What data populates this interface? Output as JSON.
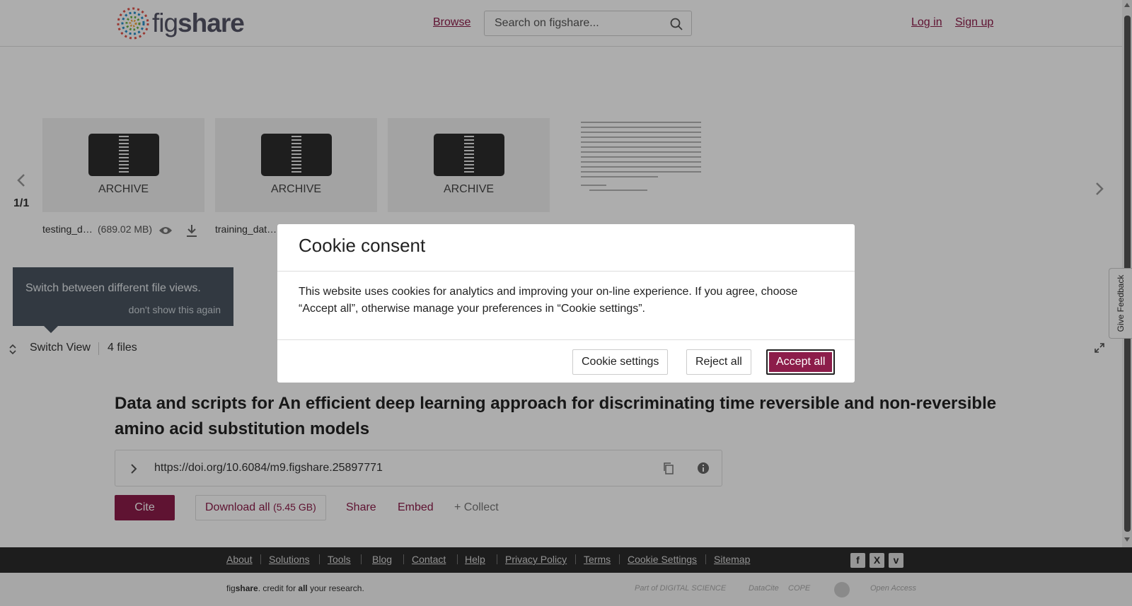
{
  "header": {
    "logo_prefix": "fig",
    "logo_suffix": "share",
    "browse_label": "Browse",
    "search_placeholder": "Search on figshare...",
    "login_label": "Log in",
    "signup_label": "Sign up"
  },
  "viewer": {
    "pager": "1/1",
    "tiles": [
      {
        "type_label": "ARCHIVE",
        "file_name": "testing_d…",
        "file_size": "(689.02 MB)"
      },
      {
        "type_label": "ARCHIVE",
        "file_name": "training_dat…"
      },
      {
        "type_label": "ARCHIVE"
      }
    ],
    "tooltip": {
      "message": "Switch between different file views.",
      "dismiss": "don't show this again"
    },
    "switch_view_label": "Switch View",
    "files_count": "4 files"
  },
  "item": {
    "title": "Data and scripts for An efficient deep learning approach for discriminating time reversible and non-reversible amino acid substitution models",
    "doi_url": "https://doi.org/10.6084/m9.figshare.25897771",
    "cite_label": "Cite",
    "download_label": "Download all",
    "download_size": "(5.45 GB)",
    "share_label": "Share",
    "embed_label": "Embed",
    "collect_label": "+ Collect"
  },
  "feedback_label": "Give Feedback",
  "footer": {
    "links": [
      "About",
      "Solutions",
      "Tools",
      "Blog",
      "Contact",
      "Help",
      "Privacy Policy",
      "Terms",
      "Cookie Settings",
      "Sitemap"
    ],
    "credit_fig": "fig",
    "credit_share": "share",
    "credit_mid": ". credit for ",
    "credit_all": "all",
    "credit_end": " your research.",
    "partners": [
      "Part of DIGITAL SCIENCE",
      "DataCite",
      "COPE",
      "Open Access"
    ]
  },
  "cookie": {
    "title": "Cookie consent",
    "body": "This website uses cookies for analytics and improving your on-line experience. If you agree, choose “Accept all”, otherwise manage your preferences in “Cookie settings”.",
    "settings_label": "Cookie settings",
    "reject_label": "Reject all",
    "accept_label": "Accept all"
  },
  "colors": {
    "brand": "#8c1d4a",
    "footer_bg": "#2b2b2b",
    "tooltip_bg": "#4a5561"
  }
}
